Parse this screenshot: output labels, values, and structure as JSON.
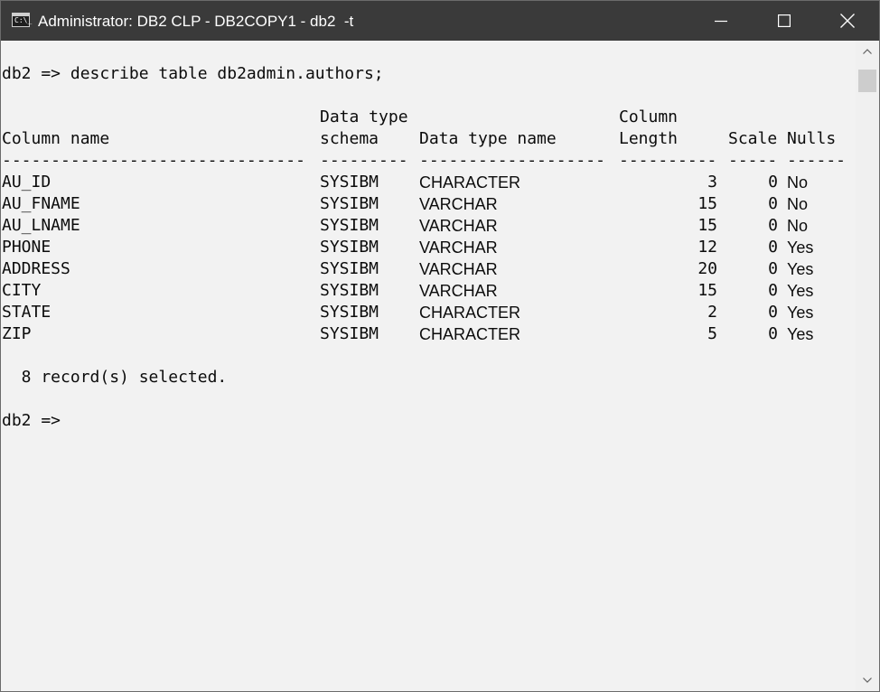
{
  "window": {
    "title": "Administrator: DB2 CLP - DB2COPY1 - db2  -t",
    "icon_label": "C:\\_"
  },
  "console": {
    "command_line": "db2 => describe table db2admin.authors;",
    "headers_top": {
      "schema": "Data type",
      "length": "Column"
    },
    "headers": {
      "column_name": "Column name",
      "schema": "schema",
      "type_name": "Data type name",
      "length": "Length",
      "scale": "Scale",
      "nulls": "Nulls"
    },
    "separators": {
      "column_name": "-------------------------------",
      "schema": "---------",
      "type_name": "-------------------",
      "length": "----------",
      "scale": "-----",
      "nulls": "------"
    },
    "rows": [
      {
        "name": "AU_ID",
        "schema": "SYSIBM",
        "type": "CHARACTER",
        "length": "3",
        "scale": "0",
        "nulls": "No"
      },
      {
        "name": "AU_FNAME",
        "schema": "SYSIBM",
        "type": "VARCHAR",
        "length": "15",
        "scale": "0",
        "nulls": "No"
      },
      {
        "name": "AU_LNAME",
        "schema": "SYSIBM",
        "type": "VARCHAR",
        "length": "15",
        "scale": "0",
        "nulls": "No"
      },
      {
        "name": "PHONE",
        "schema": "SYSIBM",
        "type": "VARCHAR",
        "length": "12",
        "scale": "0",
        "nulls": "Yes"
      },
      {
        "name": "ADDRESS",
        "schema": "SYSIBM",
        "type": "VARCHAR",
        "length": "20",
        "scale": "0",
        "nulls": "Yes"
      },
      {
        "name": "CITY",
        "schema": "SYSIBM",
        "type": "VARCHAR",
        "length": "15",
        "scale": "0",
        "nulls": "Yes"
      },
      {
        "name": "STATE",
        "schema": "SYSIBM",
        "type": "CHARACTER",
        "length": "2",
        "scale": "0",
        "nulls": "Yes"
      },
      {
        "name": "ZIP",
        "schema": "SYSIBM",
        "type": "CHARACTER",
        "length": "5",
        "scale": "0",
        "nulls": "Yes"
      }
    ],
    "result_message": "  8 record(s) selected.",
    "prompt": "db2 =>"
  },
  "icons": {
    "minimize": "minimize-icon",
    "maximize": "maximize-icon",
    "close": "close-icon",
    "scroll_up": "chevron-up-icon",
    "scroll_down": "chevron-down-icon"
  },
  "colors": {
    "titlebar": "#3a3a3a",
    "console_background": "#f2f2f2",
    "console_text": "#0c0c0c"
  }
}
